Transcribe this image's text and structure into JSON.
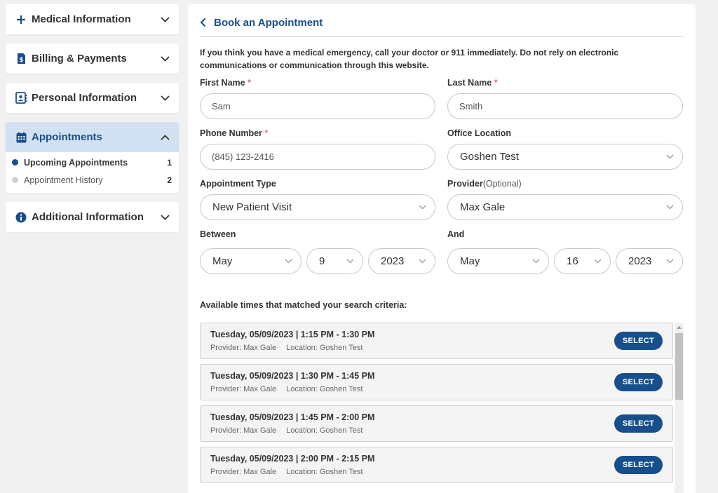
{
  "sidebar": {
    "sections": [
      {
        "label": "Medical Information",
        "icon": "plus-icon"
      },
      {
        "label": "Billing & Payments",
        "icon": "bill-icon"
      },
      {
        "label": "Personal Information",
        "icon": "contact-card-icon"
      },
      {
        "label": "Appointments",
        "icon": "calendar-icon"
      },
      {
        "label": "Additional Information",
        "icon": "info-icon"
      }
    ],
    "appointments_items": [
      {
        "label": "Upcoming Appointments",
        "count": "1"
      },
      {
        "label": "Appointment History",
        "count": "2"
      }
    ]
  },
  "main": {
    "title": "Book an Appointment",
    "notice": "If you think you have a medical emergency, call your doctor or 911 immediately. Do not rely on electronic communications or communication through this website.",
    "form": {
      "first_name": {
        "label": "First Name",
        "required": "*",
        "value": "Sam"
      },
      "last_name": {
        "label": "Last Name",
        "required": "*",
        "value": "Smith"
      },
      "phone": {
        "label": "Phone Number",
        "required": "*",
        "value": "(845) 123-2416"
      },
      "office_location": {
        "label": "Office Location",
        "value": "Goshen Test"
      },
      "appointment_type": {
        "label": "Appointment Type",
        "value": "New Patient Visit"
      },
      "provider": {
        "label": "Provider",
        "optional": "(Optional)",
        "value": "Max Gale"
      },
      "between": {
        "label": "Between",
        "month": "May",
        "day": "9",
        "year": "2023"
      },
      "and": {
        "label": "And",
        "month": "May",
        "day": "16",
        "year": "2023"
      }
    },
    "results_label": "Available times that matched your search criteria:",
    "slots": [
      {
        "time": "Tuesday, 05/09/2023 | 1:15 PM - 1:30 PM",
        "provider": "Provider: Max Gale",
        "location": "Location: Goshen Test",
        "button": "SELECT"
      },
      {
        "time": "Tuesday, 05/09/2023 | 1:30 PM - 1:45 PM",
        "provider": "Provider: Max Gale",
        "location": "Location: Goshen Test",
        "button": "SELECT"
      },
      {
        "time": "Tuesday, 05/09/2023 | 1:45 PM - 2:00 PM",
        "provider": "Provider: Max Gale",
        "location": "Location: Goshen Test",
        "button": "SELECT"
      },
      {
        "time": "Tuesday, 05/09/2023 | 2:00 PM - 2:15 PM",
        "provider": "Provider: Max Gale",
        "location": "Location: Goshen Test",
        "button": "SELECT"
      }
    ]
  },
  "colors": {
    "brand": "#174e8c",
    "active_bg": "#d1e1f1",
    "dot_active": "#174e8c",
    "dot_inactive": "#d0d0d0"
  }
}
